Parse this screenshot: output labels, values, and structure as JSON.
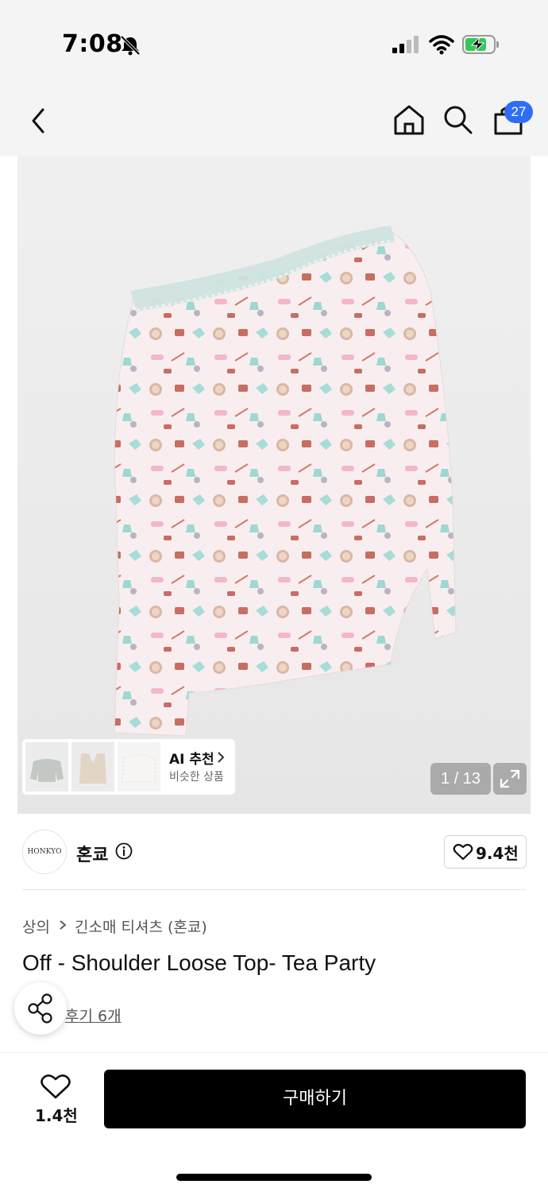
{
  "status_bar": {
    "time": "7:08"
  },
  "header": {
    "cart_count": "27"
  },
  "gallery": {
    "ai_title": "AI 추천",
    "ai_subtitle": "비슷한 상품",
    "counter": "1 / 13"
  },
  "brand": {
    "logo_text": "HONKYO",
    "name": "혼쿄",
    "likes": "9.4천"
  },
  "product": {
    "category": "상의",
    "subcategory": "긴소매 티셔츠 (혼쿄)",
    "title": "Off - Shoulder Loose Top- Tea Party",
    "reviews": "후기 6개"
  },
  "bottom_bar": {
    "likes": "1.4천",
    "buy_label": "구매하기"
  },
  "colors": {
    "accent_badge": "#2f6df6",
    "buy_button": "#000000",
    "background": "#f4f4f4"
  }
}
